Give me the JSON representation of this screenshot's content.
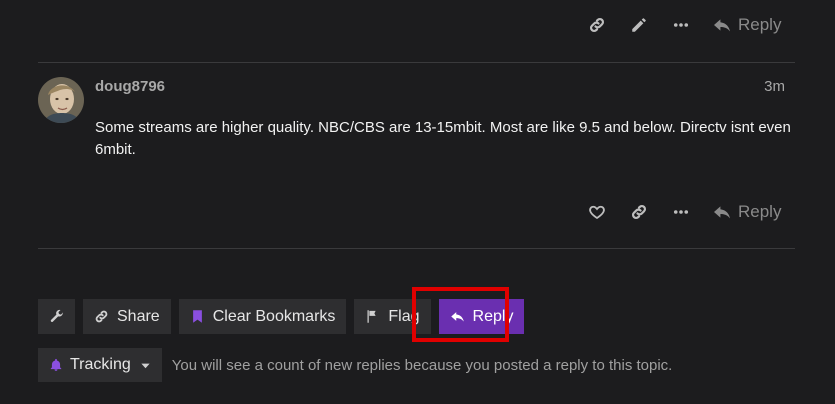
{
  "top_actions": {
    "reply_label": "Reply"
  },
  "post": {
    "username": "doug8796",
    "time": "3m",
    "body": "Some streams are higher quality. NBC/CBS are 13-15mbit. Most are like 9.5 and below. Directv isnt even 6mbit.",
    "reply_label": "Reply"
  },
  "topic_footer": {
    "share_label": "Share",
    "clear_bookmarks_label": "Clear Bookmarks",
    "flag_label": "Flag",
    "reply_label": "Reply"
  },
  "tracking": {
    "level_label": "Tracking",
    "note": "You will see a count of new replies because you posted a reply to this topic."
  },
  "colors": {
    "background": "#1c1c1e",
    "primary_button": "#6a2fb0",
    "bookmark_accent": "#8a4fe0",
    "highlight_border": "#e00000"
  },
  "icons": {
    "link": "link-icon",
    "edit": "pencil-icon",
    "more": "ellipsis-icon",
    "reply": "reply-arrow-icon",
    "like": "heart-icon",
    "admin": "wrench-icon",
    "bookmark": "bookmark-icon",
    "flag": "flag-icon",
    "tracking": "bell-icon",
    "dropdown": "caret-down-icon"
  }
}
